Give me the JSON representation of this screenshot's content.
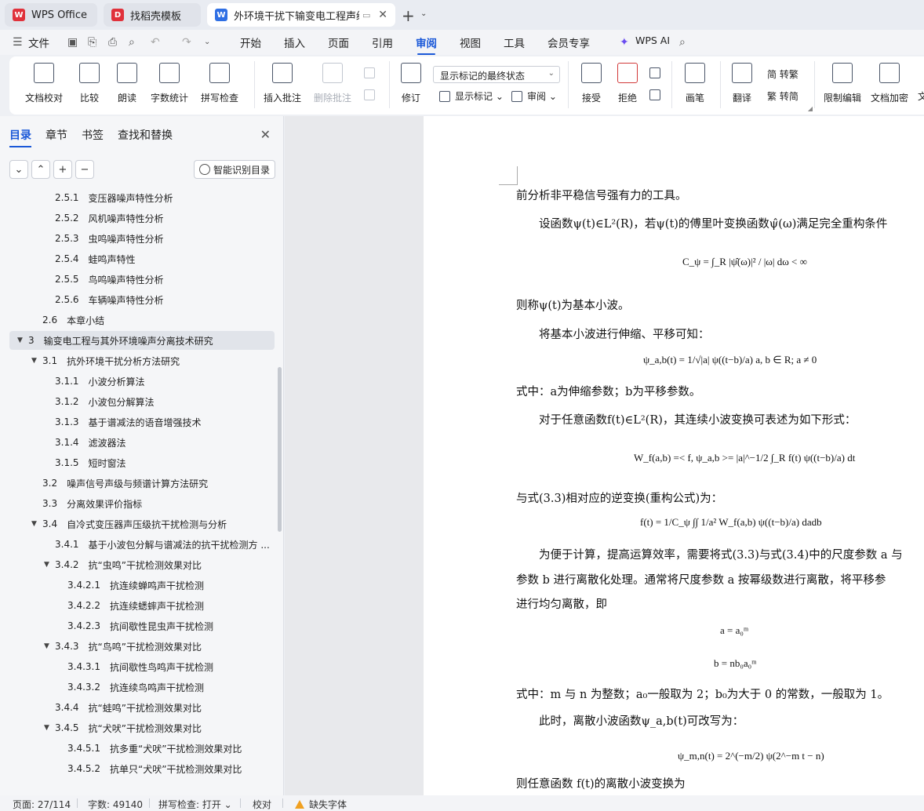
{
  "tabs": [
    {
      "label": "WPS Office",
      "icon": "wps-logo-icon"
    },
    {
      "label": "找稻壳模板",
      "icon": "docer-icon"
    },
    {
      "label": "外环境干扰下输变电工程声级测",
      "icon": "writer-doc-icon"
    }
  ],
  "menu": {
    "file": "文件",
    "items": [
      "开始",
      "插入",
      "页面",
      "引用",
      "审阅",
      "视图",
      "工具",
      "会员专享"
    ],
    "active": "审阅",
    "ai": "WPS AI"
  },
  "ribbon": {
    "proofread": "文档校对",
    "compare": "比较",
    "read_aloud": "朗读",
    "word_count": "字数统计",
    "spell_check": "拼写检查",
    "insert_comment": "插入批注",
    "delete_comment": "删除批注",
    "revise": "修订",
    "display_mode": "显示标记的最终状态",
    "show_markup": "显示标记",
    "review": "审阅",
    "accept": "接受",
    "reject": "拒绝",
    "pen": "画笔",
    "translate": "翻译",
    "trad": "简 转繁",
    "simp": "繁 转简",
    "restrict_edit": "限制编辑",
    "encrypt": "文档加密",
    "cut": "文"
  },
  "nav": {
    "tabs": [
      "目录",
      "章节",
      "书签",
      "查找和替换"
    ],
    "smart_button": "智能识别目录",
    "toc": [
      {
        "num": "2.5.1",
        "title": "变压器噪声特性分析",
        "level": 3,
        "arrow": ""
      },
      {
        "num": "2.5.2",
        "title": "风机噪声特性分析",
        "level": 3,
        "arrow": ""
      },
      {
        "num": "2.5.3",
        "title": "虫鸣噪声特性分析",
        "level": 3,
        "arrow": ""
      },
      {
        "num": "2.5.4",
        "title": "蛙鸣声特性",
        "level": 3,
        "arrow": ""
      },
      {
        "num": "2.5.5",
        "title": "鸟鸣噪声特性分析",
        "level": 3,
        "arrow": ""
      },
      {
        "num": "2.5.6",
        "title": "车辆噪声特性分析",
        "level": 3,
        "arrow": ""
      },
      {
        "num": "2.6",
        "title": "本章小结",
        "level": 2,
        "arrow": ""
      },
      {
        "num": "3",
        "title": "输变电工程与其外环境噪声分离技术研究",
        "level": 1,
        "arrow": "▼",
        "selected": true
      },
      {
        "num": "3.1",
        "title": "抗外环境干扰分析方法研究",
        "level": 2,
        "arrow": "▼"
      },
      {
        "num": "3.1.1",
        "title": "小波分析算法",
        "level": 3,
        "arrow": ""
      },
      {
        "num": "3.1.2",
        "title": "小波包分解算法",
        "level": 3,
        "arrow": ""
      },
      {
        "num": "3.1.3",
        "title": "基于谱减法的语音增强技术",
        "level": 3,
        "arrow": ""
      },
      {
        "num": "3.1.4",
        "title": "滤波器法",
        "level": 3,
        "arrow": ""
      },
      {
        "num": "3.1.5",
        "title": "短时窗法",
        "level": 3,
        "arrow": ""
      },
      {
        "num": "3.2",
        "title": "噪声信号声级与频谱计算方法研究",
        "level": 2,
        "arrow": ""
      },
      {
        "num": "3.3",
        "title": "分离效果评价指标",
        "level": 2,
        "arrow": ""
      },
      {
        "num": "3.4",
        "title": "自冷式变压器声压级抗干扰检测与分析",
        "level": 2,
        "arrow": "▼"
      },
      {
        "num": "3.4.1",
        "title": "基于小波包分解与谱减法的抗干扰检测方 ...",
        "level": 3,
        "arrow": ""
      },
      {
        "num": "3.4.2",
        "title": "抗“虫鸣”干扰检测效果对比",
        "level": 3,
        "arrow": "▼"
      },
      {
        "num": "3.4.2.1",
        "title": "抗连续蝉鸣声干扰检测",
        "level": 4,
        "arrow": ""
      },
      {
        "num": "3.4.2.2",
        "title": "抗连续蟋蟀声干扰检测",
        "level": 4,
        "arrow": ""
      },
      {
        "num": "3.4.2.3",
        "title": "抗间歇性昆虫声干扰检测",
        "level": 4,
        "arrow": ""
      },
      {
        "num": "3.4.3",
        "title": "抗“鸟鸣”干扰检测效果对比",
        "level": 3,
        "arrow": "▼"
      },
      {
        "num": "3.4.3.1",
        "title": "抗间歇性鸟鸣声干扰检测",
        "level": 4,
        "arrow": ""
      },
      {
        "num": "3.4.3.2",
        "title": "抗连续鸟鸣声干扰检测",
        "level": 4,
        "arrow": ""
      },
      {
        "num": "3.4.4",
        "title": "抗“蛙鸣”干扰检测效果对比",
        "level": 3,
        "arrow": ""
      },
      {
        "num": "3.4.5",
        "title": "抗“犬吠”干扰检测效果对比",
        "level": 3,
        "arrow": "▼"
      },
      {
        "num": "3.4.5.1",
        "title": "抗多重“犬吠”干扰检测效果对比",
        "level": 4,
        "arrow": ""
      },
      {
        "num": "3.4.5.2",
        "title": "抗单只“犬吠”干扰检测效果对比",
        "level": 4,
        "arrow": ""
      }
    ]
  },
  "doc": {
    "p1": "前分析非平稳信号强有力的工具。",
    "p2": "设函数ψ(t)∈L²(R)，若ψ(t)的傅里叶变换函数ψ̂(ω)满足完全重构条件",
    "eq1": "C_ψ = ∫_R |ψ̂(ω)|² / |ω| dω < ∞",
    "p3": "则称ψ(t)为基本小波。",
    "p4": "将基本小波进行伸缩、平移可知：",
    "eq2": "ψ_a,b(t) = 1/√|a| ψ((t−b)/a)     a, b ∈ R; a ≠ 0",
    "p5": "式中：a为伸缩参数；b为平移参数。",
    "p6": "对于任意函数f(t)∈L²(R)，其连续小波变换可表述为如下形式：",
    "eq3": "W_f(a,b) =< f, ψ_a,b >= |a|^−1/2 ∫_R f(t) ψ((t−b)/a) dt",
    "p7": "与式(3.3)相对应的逆变换(重构公式)为：",
    "eq4": "f(t) = 1/C_ψ ∫∫ 1/a² W_f(a,b) ψ((t−b)/a) dadb",
    "p8": "为便于计算，提高运算效率，需要将式(3.3)与式(3.4)中的尺度参数 a 与",
    "p9": "参数 b 进行离散化处理。通常将尺度参数 a 按幂级数进行离散，将平移参",
    "p10": "进行均匀离散，即",
    "eq5": "a = a₀ᵐ",
    "eq6": "b = nb₀a₀ᵐ",
    "p11": "式中：m 与 n 为整数；a₀一般取为 2；b₀为大于 0 的常数，一般取为 1。",
    "p12": "此时，离散小波函数ψ_a,b(t)可改写为：",
    "eq7": "ψ_m,n(t) = 2^(−m/2) ψ(2^−m t − n)",
    "p13": "则任意函数 f(t)的离散小波变换为"
  },
  "status": {
    "page": "页面: 27/114",
    "words": "字数: 49140",
    "spell": "拼写检查: 打开",
    "proof": "校对",
    "missing_font": "缺失字体"
  },
  "colors": {
    "accent": "#1a58d8",
    "wps_red": "#e0313b",
    "writer_blue": "#2f6fe4",
    "warning": "#f0a020"
  }
}
